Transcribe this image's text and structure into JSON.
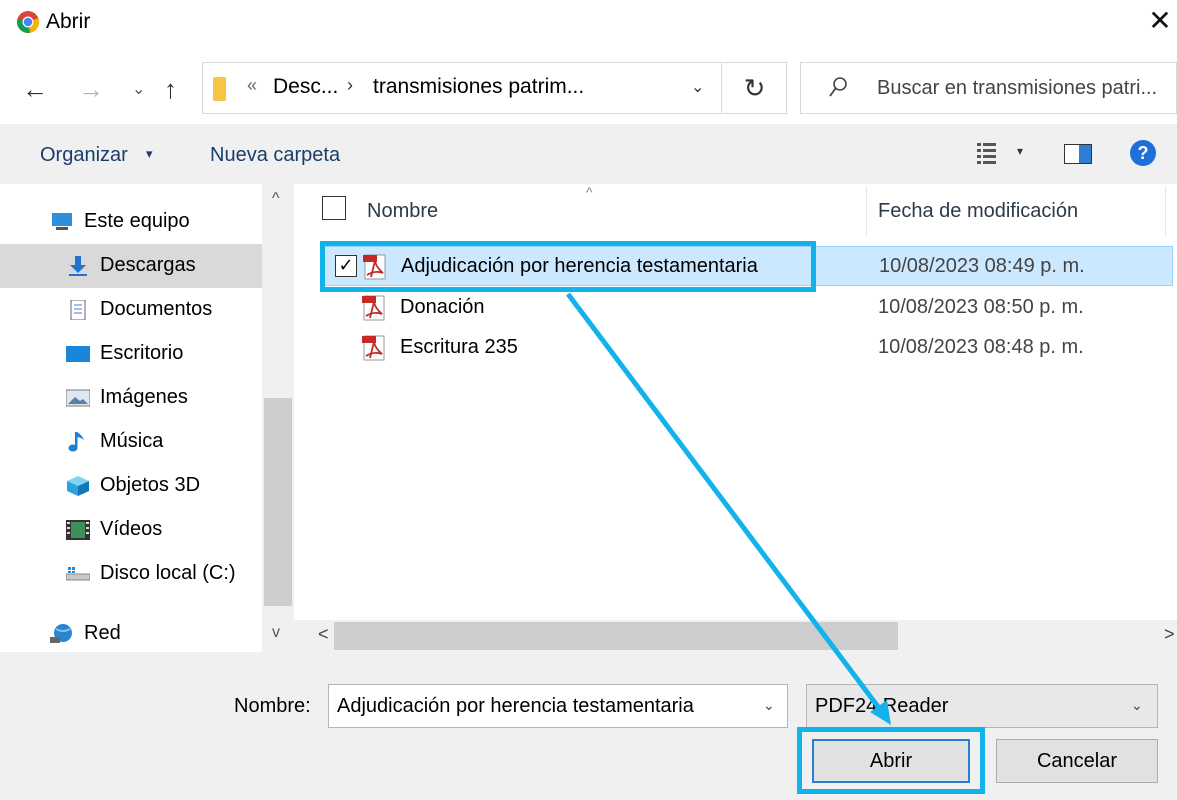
{
  "window": {
    "title": "Abrir",
    "close_glyph": "✕"
  },
  "nav": {
    "back": "←",
    "forward": "→",
    "recent": "⌄",
    "up": "↑",
    "address": {
      "chevron": "«",
      "segment1": "Desc...",
      "separator": "›",
      "segment2": "transmisiones patrim...",
      "dropdown": "⌄"
    },
    "refresh": "↻",
    "search_placeholder": "Buscar en transmisiones patri..."
  },
  "toolbar": {
    "organize": "Organizar",
    "organize_caret": "▾",
    "new_folder": "Nueva carpeta",
    "view_caret": "▾",
    "help": "?"
  },
  "sidebar": {
    "items": [
      {
        "label": "Este equipo",
        "icon": "computer-icon"
      },
      {
        "label": "Descargas",
        "icon": "downloads-icon",
        "selected": true
      },
      {
        "label": "Documentos",
        "icon": "documents-icon"
      },
      {
        "label": "Escritorio",
        "icon": "desktop-icon"
      },
      {
        "label": "Imágenes",
        "icon": "pictures-icon"
      },
      {
        "label": "Música",
        "icon": "music-icon"
      },
      {
        "label": "Objetos 3D",
        "icon": "3d-objects-icon"
      },
      {
        "label": "Vídeos",
        "icon": "videos-icon"
      },
      {
        "label": "Disco local (C:)",
        "icon": "drive-icon"
      },
      {
        "label": "Red",
        "icon": "network-icon"
      }
    ],
    "scroll_up": "^",
    "scroll_down": "v"
  },
  "columns": {
    "name": "Nombre",
    "date": "Fecha de modificación",
    "sort_arrow": "^"
  },
  "files": [
    {
      "name": "Adjudicación por herencia testamentaria",
      "date": "10/08/2023 08:49 p. m.",
      "selected": true,
      "check": "✓"
    },
    {
      "name": "Donación",
      "date": "10/08/2023 08:50 p. m."
    },
    {
      "name": "Escritura 235",
      "date": "10/08/2023 08:48 p. m."
    }
  ],
  "hscroll": {
    "left": "<",
    "right": ">"
  },
  "footer": {
    "name_label": "Nombre:",
    "name_value": "Adjudicación por herencia testamentaria",
    "file_type": "PDF24 Reader",
    "dropdown": "⌄",
    "open": "Abrir",
    "cancel": "Cancelar"
  },
  "colors": {
    "annotation": "#12b3ea",
    "selection": "#cce8ff",
    "toolbar_bg": "#f0f0f0"
  }
}
